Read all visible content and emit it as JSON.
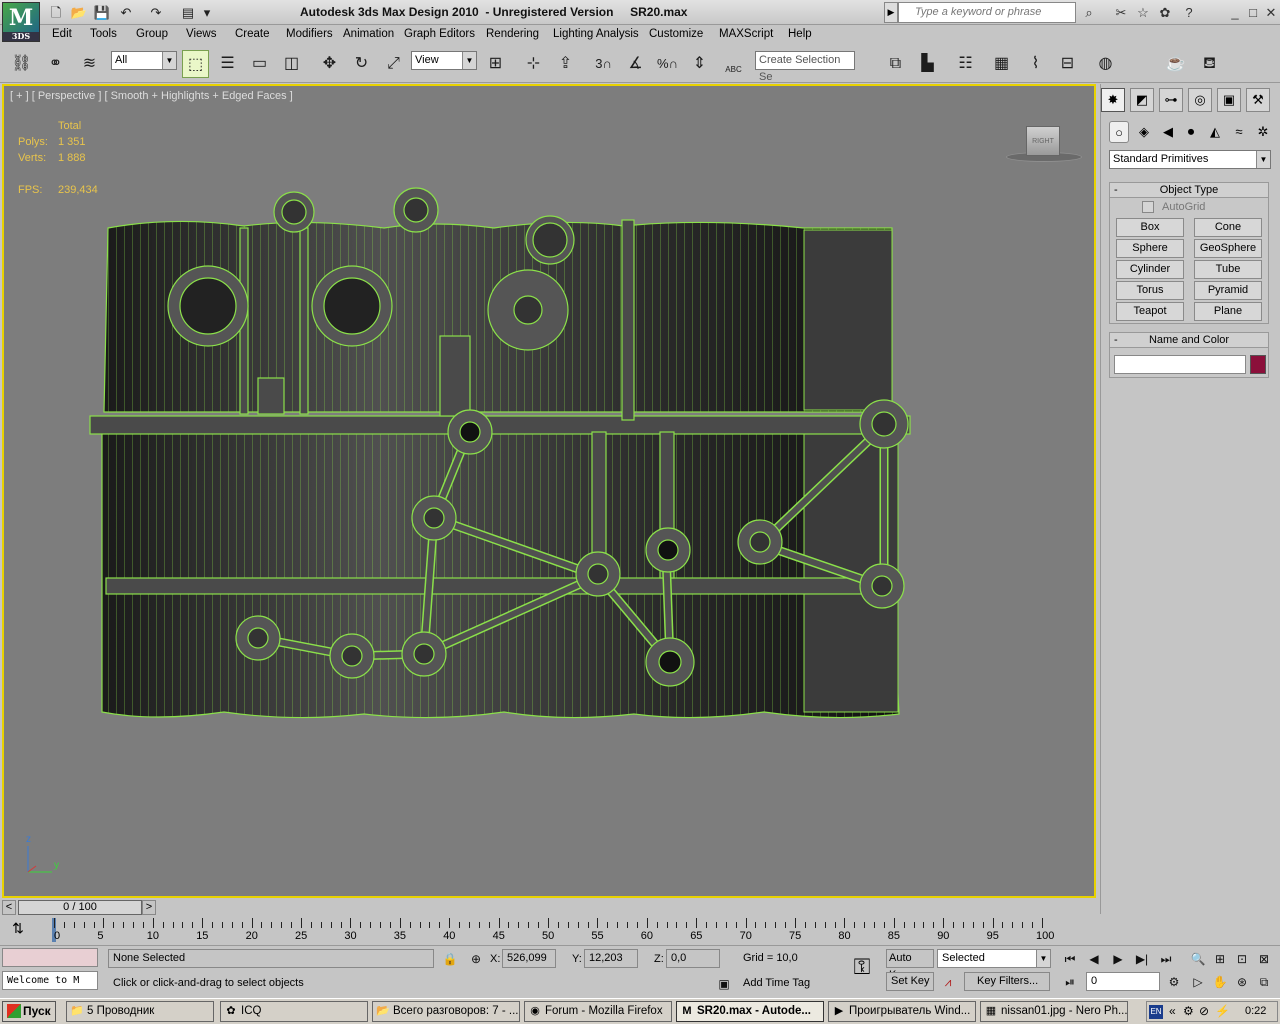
{
  "titlebar": {
    "app_logo": "3DS",
    "title": "Autodesk 3ds Max Design 2010  - Unregistered Version     SR20.max",
    "search_placeholder": "Type a keyword or phrase",
    "window_controls": [
      "_",
      "□",
      "✕"
    ]
  },
  "menu": [
    "Edit",
    "Tools",
    "Group",
    "Views",
    "Create",
    "Modifiers",
    "Animation",
    "Graph Editors",
    "Rendering",
    "Lighting Analysis",
    "Customize",
    "MAXScript",
    "Help"
  ],
  "toolbar": {
    "selection_filter": "All",
    "ref_coord": "View",
    "snap_labels": [
      "3",
      "%"
    ],
    "named_selection_placeholder": "Create Selection Se",
    "text_abc": "ABC"
  },
  "viewport": {
    "label": "[ + ] [ Perspective ] [ Smooth + Highlights + Edged Faces ]",
    "stats_header": "Total",
    "polys_label": "Polys:",
    "polys_value": "1 351",
    "verts_label": "Verts:",
    "verts_value": "1 888",
    "fps_label": "FPS:",
    "fps_value": "239,434",
    "viewcube_label": "RIGHT",
    "axis_z": "z",
    "axis_y": "y",
    "border_color": "#e8d200",
    "wire_color": "#8be04a"
  },
  "command_panel": {
    "tabs": [
      "create",
      "modify",
      "hierarchy",
      "motion",
      "display",
      "utilities"
    ],
    "category": "Standard Primitives",
    "object_type_title": "Object Type",
    "autogrid": "AutoGrid",
    "buttons": [
      "Box",
      "Cone",
      "Sphere",
      "GeoSphere",
      "Cylinder",
      "Tube",
      "Torus",
      "Pyramid",
      "Teapot",
      "Plane"
    ],
    "name_color_title": "Name and Color",
    "name_value": "",
    "object_color": "#8b0f3a"
  },
  "timeslider": {
    "position": "0 / 100",
    "ticks": [
      "0",
      "5",
      "10",
      "15",
      "20",
      "25",
      "30",
      "35",
      "40",
      "45",
      "50",
      "55",
      "60",
      "65",
      "70",
      "75",
      "80",
      "85",
      "90",
      "95",
      "100"
    ]
  },
  "status": {
    "maxscript_listener": "Welcome to M",
    "selection": "None Selected",
    "prompt": "Click or click-and-drag to select objects",
    "x_label": "X:",
    "x_value": "526,099",
    "y_label": "Y:",
    "y_value": "12,203",
    "z_label": "Z:",
    "z_value": "0,0",
    "grid": "Grid = 10,0",
    "add_time_tag": "Add Time Tag",
    "auto_key": "Auto Key",
    "set_key": "Set Key",
    "key_mode": "Selected",
    "key_filters": "Key Filters...",
    "frame": "0"
  },
  "taskbar": {
    "start": "Пуск",
    "tasks": [
      "5 Проводник",
      "ICQ",
      "Всего разговоров: 7 - ...",
      "Forum - Mozilla Firefox",
      "SR20.max - Autode...",
      "Проигрыватель Wind...",
      "nissan01.jpg - Nero Ph..."
    ],
    "lang": "EN",
    "clock": "0:22"
  }
}
